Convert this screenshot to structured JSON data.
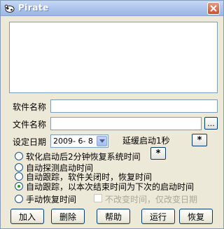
{
  "window": {
    "title": "Pirate"
  },
  "form": {
    "software_name_label": "软件名称",
    "software_name_value": "",
    "file_name_label": "文件名称",
    "file_name_value": "",
    "browse_label": "...",
    "date_label": "设定日期",
    "date_value": "2009- 6- 8",
    "delay_label": "延缓启动1秒",
    "delay_button_label": "*",
    "option_button_label": "*"
  },
  "options": [
    {
      "label": "软化启动后2分钟恢复系统时间",
      "checked": false
    },
    {
      "label": "自动探测启动时间",
      "checked": false
    },
    {
      "label": "自动跟踪，软件关闭时，恢复时间",
      "checked": false
    },
    {
      "label": "自动跟踪，以本次结束时间为下次的启动时间",
      "checked": true
    },
    {
      "label": "手动恢复时间",
      "checked": false
    }
  ],
  "no_change_time": {
    "label": "不改变时间，仅改变日期",
    "checked": false,
    "enabled": false
  },
  "buttons": {
    "add": "加入",
    "delete": "删除",
    "help": "帮助",
    "run": "运行",
    "restore": "恢复"
  },
  "icons": {
    "app": "cow-icon",
    "close": "close-icon",
    "dropdown": "chevron-down-icon"
  },
  "colors": {
    "titlebar": "#b0c7ee",
    "close": "#c8502c",
    "background": "#ece9d8",
    "radio_dot": "#21a121"
  }
}
